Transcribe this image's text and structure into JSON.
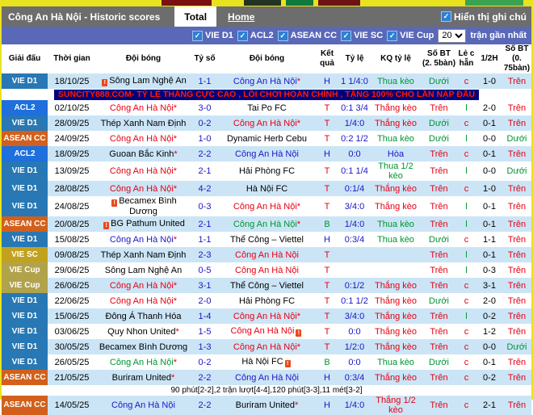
{
  "title_bar": {
    "title": "Công An Hà Nội - Historic scores",
    "tab_total": "Total",
    "tab_home": "Home",
    "show_notes": "Hiển thị ghi chú",
    "checkbox_glyph": "✓"
  },
  "filter_bar": {
    "leagues": [
      "VIE D1",
      "ACL2",
      "ASEAN CC",
      "VIE SC",
      "VIE Cup"
    ],
    "count": "20",
    "suffix": "trận gần nhất"
  },
  "banner_text": "SUNCITY888.COM- TỶ LỆ THẮNG CỰC CAO , LỐI CHƠI HOÀN CHỈNH , TẶNG 100% CHO LẦN NẠP ĐẦU",
  "note_text": "90 phút[2-2],2 trận lượt[4-4],120 phút[3-3],11 mét[3-2]",
  "colors": {
    "red": "#e60012",
    "green": "#009430",
    "blue": "#1a16c8",
    "black": "#000000",
    "zebra_blue": "#cbe5f6",
    "zebra_white": "#ffffff",
    "league": {
      "VIE D1": "#2778b4",
      "ACL2": "#1f6fdc",
      "ASEAN CC": "#d2601c",
      "VIE SC": "#c2a11e",
      "VIE Cup": "#b1a24c"
    }
  },
  "table": {
    "headers": [
      "Giải đấu",
      "Thời gian",
      "Đội bóng",
      "Tỷ số",
      "Đội bóng",
      "Kết quả",
      "Tỷ lệ",
      "KQ tỷ lệ",
      "Số BT (2. 5bàn)",
      "Lẻ c hẵn",
      "1/2H",
      "Số BT (0. 75bàn)"
    ],
    "rows": [
      {
        "type": "match",
        "league": "VIE D1",
        "zebra": "blue",
        "date": "18/10/25",
        "home": {
          "name": "Sông Lam Nghệ An",
          "color": "black",
          "star": false,
          "card": "before"
        },
        "score": "1-1",
        "away": {
          "name": "Công An Hà Nội",
          "color": "blue",
          "star": true,
          "card": null
        },
        "result": {
          "t": "H",
          "c": "blue"
        },
        "odds": "1 1/4:0",
        "kq": {
          "t": "Thua kèo",
          "c": "green"
        },
        "bt25": {
          "t": "Dưới",
          "c": "green"
        },
        "oe": {
          "t": "c",
          "c": "red"
        },
        "h1": "1-0",
        "bt075": {
          "t": "Trên",
          "c": "red"
        }
      },
      {
        "type": "banner"
      },
      {
        "type": "match",
        "league": "ACL2",
        "zebra": "white",
        "date": "02/10/25",
        "home": {
          "name": "Công An Hà Nội",
          "color": "red",
          "star": true,
          "card": null
        },
        "score": "3-0",
        "away": {
          "name": "Tai Po FC",
          "color": "black",
          "star": false,
          "card": null
        },
        "result": {
          "t": "T",
          "c": "red"
        },
        "odds": "0:1 3/4",
        "kq": {
          "t": "Thắng kèo",
          "c": "red"
        },
        "bt25": {
          "t": "Trên",
          "c": "red"
        },
        "oe": {
          "t": "l",
          "c": "green"
        },
        "h1": "2-0",
        "bt075": {
          "t": "Trên",
          "c": "red"
        }
      },
      {
        "type": "match",
        "league": "VIE D1",
        "zebra": "blue",
        "date": "28/09/25",
        "home": {
          "name": "Thép Xanh Nam Định",
          "color": "black",
          "star": false,
          "card": null
        },
        "score": "0-2",
        "away": {
          "name": "Công An Hà Nội",
          "color": "red",
          "star": true,
          "card": null
        },
        "result": {
          "t": "T",
          "c": "red"
        },
        "odds": "1/4:0",
        "kq": {
          "t": "Thắng kèo",
          "c": "red"
        },
        "bt25": {
          "t": "Dưới",
          "c": "green"
        },
        "oe": {
          "t": "c",
          "c": "red"
        },
        "h1": "0-1",
        "bt075": {
          "t": "Trên",
          "c": "red"
        }
      },
      {
        "type": "match",
        "league": "ASEAN CC",
        "zebra": "white",
        "date": "24/09/25",
        "home": {
          "name": "Công An Hà Nội",
          "color": "red",
          "star": true,
          "card": null
        },
        "score": "1-0",
        "away": {
          "name": "Dynamic Herb Cebu",
          "color": "black",
          "star": false,
          "card": null
        },
        "result": {
          "t": "T",
          "c": "red"
        },
        "odds": "0:2 1/2",
        "kq": {
          "t": "Thua kèo",
          "c": "green"
        },
        "bt25": {
          "t": "Dưới",
          "c": "green"
        },
        "oe": {
          "t": "l",
          "c": "green"
        },
        "h1": "0-0",
        "bt075": {
          "t": "Dưới",
          "c": "green"
        }
      },
      {
        "type": "match",
        "league": "ACL2",
        "zebra": "blue",
        "date": "18/09/25",
        "home": {
          "name": "Guoan Bắc Kinh",
          "color": "black",
          "star": true,
          "card": null
        },
        "score": "2-2",
        "away": {
          "name": "Công An Hà Nội",
          "color": "blue",
          "star": false,
          "card": null
        },
        "result": {
          "t": "H",
          "c": "blue"
        },
        "odds": "0:0",
        "kq": {
          "t": "Hòa",
          "c": "blue"
        },
        "bt25": {
          "t": "Trên",
          "c": "red"
        },
        "oe": {
          "t": "c",
          "c": "red"
        },
        "h1": "0-1",
        "bt075": {
          "t": "Trên",
          "c": "red"
        }
      },
      {
        "type": "match",
        "league": "VIE D1",
        "zebra": "white",
        "date": "13/09/25",
        "home": {
          "name": "Công An Hà Nội",
          "color": "red",
          "star": true,
          "card": null
        },
        "score": "2-1",
        "away": {
          "name": "Hải Phòng FC",
          "color": "black",
          "star": false,
          "card": null
        },
        "result": {
          "t": "T",
          "c": "red"
        },
        "odds": "0:1 1/4",
        "kq": {
          "t": "Thua 1/2 kèo",
          "c": "green"
        },
        "bt25": {
          "t": "Trên",
          "c": "red"
        },
        "oe": {
          "t": "l",
          "c": "green"
        },
        "h1": "0-0",
        "bt075": {
          "t": "Dưới",
          "c": "green"
        }
      },
      {
        "type": "match",
        "league": "VIE D1",
        "zebra": "blue",
        "date": "28/08/25",
        "home": {
          "name": "Công An Hà Nội",
          "color": "red",
          "star": true,
          "card": null
        },
        "score": "4-2",
        "away": {
          "name": "Hà Nội FC",
          "color": "black",
          "star": false,
          "card": null
        },
        "result": {
          "t": "T",
          "c": "red"
        },
        "odds": "0:1/4",
        "kq": {
          "t": "Thắng kèo",
          "c": "red"
        },
        "bt25": {
          "t": "Trên",
          "c": "red"
        },
        "oe": {
          "t": "c",
          "c": "red"
        },
        "h1": "1-0",
        "bt075": {
          "t": "Trên",
          "c": "red"
        }
      },
      {
        "type": "match",
        "league": "VIE D1",
        "zebra": "white",
        "date": "24/08/25",
        "home": {
          "name": "Becamex Bình Dương",
          "color": "black",
          "star": false,
          "card": "before"
        },
        "score": "0-3",
        "away": {
          "name": "Công An Hà Nội",
          "color": "red",
          "star": true,
          "card": null
        },
        "result": {
          "t": "T",
          "c": "red"
        },
        "odds": "3/4:0",
        "kq": {
          "t": "Thắng kèo",
          "c": "red"
        },
        "bt25": {
          "t": "Trên",
          "c": "red"
        },
        "oe": {
          "t": "l",
          "c": "green"
        },
        "h1": "0-1",
        "bt075": {
          "t": "Trên",
          "c": "red"
        }
      },
      {
        "type": "match",
        "league": "ASEAN CC",
        "zebra": "blue",
        "date": "20/08/25",
        "home": {
          "name": "BG Pathum United",
          "color": "black",
          "star": false,
          "card": "before"
        },
        "score": "2-1",
        "away": {
          "name": "Công An Hà Nội",
          "color": "green",
          "star": true,
          "card": null
        },
        "result": {
          "t": "B",
          "c": "green"
        },
        "odds": "1/4:0",
        "kq": {
          "t": "Thua kèo",
          "c": "green"
        },
        "bt25": {
          "t": "Trên",
          "c": "red"
        },
        "oe": {
          "t": "l",
          "c": "green"
        },
        "h1": "0-1",
        "bt075": {
          "t": "Trên",
          "c": "red"
        }
      },
      {
        "type": "match",
        "league": "VIE D1",
        "zebra": "white",
        "date": "15/08/25",
        "home": {
          "name": "Công An Hà Nội",
          "color": "blue",
          "star": true,
          "card": null
        },
        "score": "1-1",
        "away": {
          "name": "Thể Công – Viettel",
          "color": "black",
          "star": false,
          "card": null
        },
        "result": {
          "t": "H",
          "c": "blue"
        },
        "odds": "0:3/4",
        "kq": {
          "t": "Thua kèo",
          "c": "green"
        },
        "bt25": {
          "t": "Dưới",
          "c": "green"
        },
        "oe": {
          "t": "c",
          "c": "red"
        },
        "h1": "1-1",
        "bt075": {
          "t": "Trên",
          "c": "red"
        }
      },
      {
        "type": "match",
        "league": "VIE SC",
        "zebra": "blue",
        "date": "09/08/25",
        "home": {
          "name": "Thép Xanh Nam Định",
          "color": "black",
          "star": false,
          "card": null
        },
        "score": "2-3",
        "away": {
          "name": "Công An Hà Nội",
          "color": "red",
          "star": false,
          "card": null
        },
        "result": {
          "t": "T",
          "c": "red"
        },
        "odds": "",
        "kq": {
          "t": "",
          "c": "black"
        },
        "bt25": {
          "t": "Trên",
          "c": "red"
        },
        "oe": {
          "t": "l",
          "c": "green"
        },
        "h1": "0-1",
        "bt075": {
          "t": "Trên",
          "c": "red"
        }
      },
      {
        "type": "match",
        "league": "VIE Cup",
        "zebra": "white",
        "date": "29/06/25",
        "home": {
          "name": "Sông Lam Nghệ An",
          "color": "black",
          "star": false,
          "card": null
        },
        "score": "0-5",
        "away": {
          "name": "Công An Hà Nội",
          "color": "red",
          "star": false,
          "card": null
        },
        "result": {
          "t": "T",
          "c": "red"
        },
        "odds": "",
        "kq": {
          "t": "",
          "c": "black"
        },
        "bt25": {
          "t": "Trên",
          "c": "red"
        },
        "oe": {
          "t": "l",
          "c": "green"
        },
        "h1": "0-3",
        "bt075": {
          "t": "Trên",
          "c": "red"
        }
      },
      {
        "type": "match",
        "league": "VIE Cup",
        "zebra": "blue",
        "date": "26/06/25",
        "home": {
          "name": "Công An Hà Nội",
          "color": "red",
          "star": true,
          "card": null
        },
        "score": "3-1",
        "away": {
          "name": "Thể Công – Viettel",
          "color": "black",
          "star": false,
          "card": null
        },
        "result": {
          "t": "T",
          "c": "red"
        },
        "odds": "0:1/2",
        "kq": {
          "t": "Thắng kèo",
          "c": "red"
        },
        "bt25": {
          "t": "Trên",
          "c": "red"
        },
        "oe": {
          "t": "c",
          "c": "red"
        },
        "h1": "3-1",
        "bt075": {
          "t": "Trên",
          "c": "red"
        }
      },
      {
        "type": "match",
        "league": "VIE D1",
        "zebra": "white",
        "date": "22/06/25",
        "home": {
          "name": "Công An Hà Nội",
          "color": "red",
          "star": true,
          "card": null
        },
        "score": "2-0",
        "away": {
          "name": "Hải Phòng FC",
          "color": "black",
          "star": false,
          "card": null
        },
        "result": {
          "t": "T",
          "c": "red"
        },
        "odds": "0:1 1/2",
        "kq": {
          "t": "Thắng kèo",
          "c": "red"
        },
        "bt25": {
          "t": "Dưới",
          "c": "green"
        },
        "oe": {
          "t": "c",
          "c": "red"
        },
        "h1": "2-0",
        "bt075": {
          "t": "Trên",
          "c": "red"
        }
      },
      {
        "type": "match",
        "league": "VIE D1",
        "zebra": "blue",
        "date": "15/06/25",
        "home": {
          "name": "Đông Á Thanh Hóa",
          "color": "black",
          "star": false,
          "card": null
        },
        "score": "1-4",
        "away": {
          "name": "Công An Hà Nội",
          "color": "red",
          "star": true,
          "card": null
        },
        "result": {
          "t": "T",
          "c": "red"
        },
        "odds": "3/4:0",
        "kq": {
          "t": "Thắng kèo",
          "c": "red"
        },
        "bt25": {
          "t": "Trên",
          "c": "red"
        },
        "oe": {
          "t": "l",
          "c": "green"
        },
        "h1": "0-2",
        "bt075": {
          "t": "Trên",
          "c": "red"
        }
      },
      {
        "type": "match",
        "league": "VIE D1",
        "zebra": "white",
        "date": "03/06/25",
        "home": {
          "name": "Quy Nhon United",
          "color": "black",
          "star": true,
          "card": null
        },
        "score": "1-5",
        "away": {
          "name": "Công An Hà Nội",
          "color": "red",
          "star": false,
          "card": "after"
        },
        "result": {
          "t": "T",
          "c": "red"
        },
        "odds": "0:0",
        "kq": {
          "t": "Thắng kèo",
          "c": "red"
        },
        "bt25": {
          "t": "Trên",
          "c": "red"
        },
        "oe": {
          "t": "c",
          "c": "red"
        },
        "h1": "1-2",
        "bt075": {
          "t": "Trên",
          "c": "red"
        }
      },
      {
        "type": "match",
        "league": "VIE D1",
        "zebra": "blue",
        "date": "30/05/25",
        "home": {
          "name": "Becamex Bình Dương",
          "color": "black",
          "star": false,
          "card": null
        },
        "score": "1-3",
        "away": {
          "name": "Công An Hà Nội",
          "color": "red",
          "star": true,
          "card": null
        },
        "result": {
          "t": "T",
          "c": "red"
        },
        "odds": "1/2:0",
        "kq": {
          "t": "Thắng kèo",
          "c": "red"
        },
        "bt25": {
          "t": "Trên",
          "c": "red"
        },
        "oe": {
          "t": "c",
          "c": "red"
        },
        "h1": "0-0",
        "bt075": {
          "t": "Dưới",
          "c": "green"
        }
      },
      {
        "type": "match",
        "league": "VIE D1",
        "zebra": "white",
        "date": "26/05/25",
        "home": {
          "name": "Công An Hà Nội",
          "color": "green",
          "star": true,
          "card": null
        },
        "score": "0-2",
        "away": {
          "name": "Hà Nội FC",
          "color": "black",
          "star": false,
          "card": "after"
        },
        "result": {
          "t": "B",
          "c": "green"
        },
        "odds": "0:0",
        "kq": {
          "t": "Thua kèo",
          "c": "green"
        },
        "bt25": {
          "t": "Dưới",
          "c": "green"
        },
        "oe": {
          "t": "c",
          "c": "red"
        },
        "h1": "0-1",
        "bt075": {
          "t": "Trên",
          "c": "red"
        }
      },
      {
        "type": "match",
        "league": "ASEAN CC",
        "zebra": "blue",
        "date": "21/05/25",
        "home": {
          "name": "Buriram United",
          "color": "black",
          "star": true,
          "card": null
        },
        "score": "2-2",
        "away": {
          "name": "Công An Hà Nội",
          "color": "blue",
          "star": false,
          "card": null
        },
        "result": {
          "t": "H",
          "c": "blue"
        },
        "odds": "0:3/4",
        "kq": {
          "t": "Thắng kèo",
          "c": "red"
        },
        "bt25": {
          "t": "Trên",
          "c": "red"
        },
        "oe": {
          "t": "c",
          "c": "red"
        },
        "h1": "0-2",
        "bt075": {
          "t": "Trên",
          "c": "red"
        }
      },
      {
        "type": "note"
      },
      {
        "type": "match",
        "league": "ASEAN CC",
        "zebra": "blue",
        "date": "14/05/25",
        "home": {
          "name": "Công An Hà Nội",
          "color": "blue",
          "star": false,
          "card": null
        },
        "score": "2-2",
        "away": {
          "name": "Buriram United",
          "color": "black",
          "star": true,
          "card": null
        },
        "result": {
          "t": "H",
          "c": "blue"
        },
        "odds": "1/4:0",
        "kq": {
          "t": "Thắng 1/2 kèo",
          "c": "red"
        },
        "bt25": {
          "t": "Trên",
          "c": "red"
        },
        "oe": {
          "t": "c",
          "c": "red"
        },
        "h1": "2-1",
        "bt075": {
          "t": "Trên",
          "c": "red"
        }
      }
    ]
  }
}
